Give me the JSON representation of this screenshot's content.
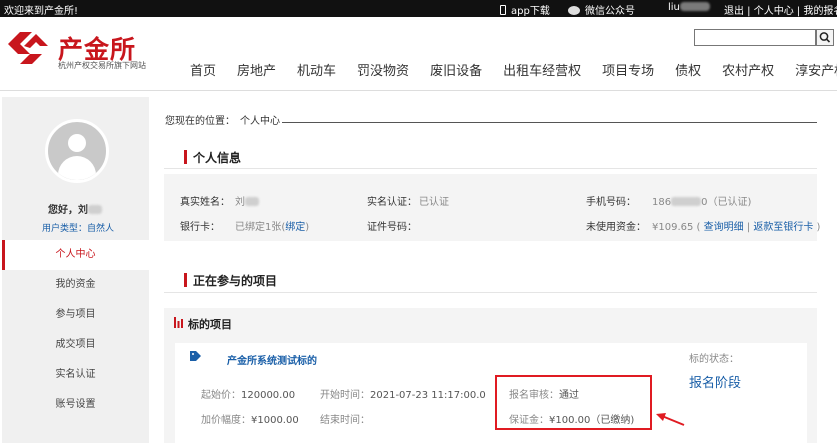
{
  "topbar": {
    "welcome": "欢迎来到产金所!",
    "app_download": "app下载",
    "wechat": "微信公众号",
    "user": "liu",
    "links": "退出 | 个人中心 | 我的报名"
  },
  "header": {
    "logo_text": "产金所",
    "logo_sub": "杭州产权交易所旗下网站",
    "search": {
      "value": "",
      "placeholder": ""
    }
  },
  "nav": [
    "首页",
    "房地产",
    "机动车",
    "罚没物资",
    "废旧设备",
    "出租车经营权",
    "项目专场",
    "债权",
    "农村产权",
    "淳安产权"
  ],
  "sidebar": {
    "greeting": "您好，刘",
    "user_type": "用户类型：自然人",
    "items": [
      "个人中心",
      "我的资金",
      "参与项目",
      "成交项目",
      "实名认证",
      "账号设置"
    ]
  },
  "breadcrumb": {
    "label": "您现在的位置：",
    "current": "个人中心"
  },
  "personal_info": {
    "title": "个人信息",
    "real_name_label": "真实姓名：",
    "real_name": "刘",
    "realname_auth_label": "实名认证：",
    "realname_auth": "已认证",
    "phone_label": "手机号码：",
    "phone_prefix": "186",
    "phone_suffix": "0（已认证)",
    "bankcard_label": "银行卡：",
    "bankcard": "已绑定1张(",
    "bankcard_link": "绑定",
    "bankcard_end": ")",
    "idno_label": "证件号码：",
    "unused_label": "未使用资金：",
    "unused_amount": "¥109.65",
    "query_link": "查询明细",
    "refund_link": "返款至银行卡"
  },
  "projects": {
    "title": "正在参与的项目",
    "section_label": "标的项目",
    "item": {
      "name": "产金所系统测试标的",
      "status_label": "标的状态：",
      "status": "报名阶段",
      "start_price_label": "起始价：",
      "start_price": "120000.00",
      "start_time_label": "开始时间：",
      "start_time": "2021-07-23 11:17:00.0",
      "increment_label": "加价幅度：",
      "increment": "¥1000.00",
      "end_time_label": "结束时间：",
      "end_time": "",
      "review_label": "报名审核：",
      "review": "通过",
      "deposit_label": "保证金：",
      "deposit": "¥100.00（已缴纳)"
    }
  },
  "colors": {
    "accent": "#c8161d",
    "link": "#1a5fa8",
    "highlight": "#e01b22"
  }
}
